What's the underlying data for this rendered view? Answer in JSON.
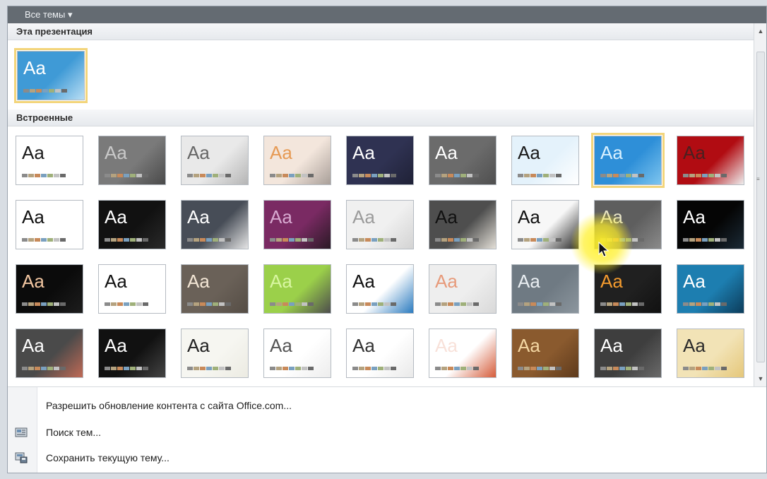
{
  "header": {
    "title": "Все темы ▾"
  },
  "sections": {
    "this_presentation": "Эта презентация",
    "builtin": "Встроенные"
  },
  "menu": [
    {
      "label": "Разрешить обновление контента с сайта Office.com...",
      "icon": ""
    },
    {
      "label": "Поиск тем...",
      "icon": "browse-themes-icon"
    },
    {
      "label": "Сохранить текущую тему...",
      "icon": "save-theme-icon"
    }
  ],
  "current_theme": {
    "label": "Aa",
    "bg": "#3f9ad6",
    "bg2": "#b9def4",
    "fg": "#ffffff"
  },
  "themes": [
    {
      "label": "Aa",
      "bg": "#ffffff",
      "bg2": "#ffffff",
      "fg": "#1a1a1a"
    },
    {
      "label": "Aa",
      "bg": "#7a7a7a",
      "bg2": "#4a4a4a",
      "fg": "#c9c9c9"
    },
    {
      "label": "Aa",
      "bg": "#e9e9e9",
      "bg2": "#b5b5b5",
      "fg": "#666666"
    },
    {
      "label": "Aa",
      "bg": "#f3e6dc",
      "bg2": "#a99f99",
      "fg": "#e69a54"
    },
    {
      "label": "Aa",
      "bg": "#2f3252",
      "bg2": "#1f2136",
      "fg": "#ffffff"
    },
    {
      "label": "Aa",
      "bg": "#6b6b6b",
      "bg2": "#4f4f4f",
      "fg": "#ffffff"
    },
    {
      "label": "Aa",
      "bg": "#e4f2fb",
      "bg2": "#ffffff",
      "fg": "#1a1a1a"
    },
    {
      "label": "Aa",
      "bg": "#2e8fd8",
      "bg2": "#7ec5ef",
      "fg": "#d7f0ff"
    },
    {
      "label": "Aa",
      "bg": "#b10c12",
      "bg2": "#eeeeee",
      "fg": "#4a2020"
    },
    {
      "label": "Aa",
      "bg": "#ffffff",
      "bg2": "#ffffff",
      "fg": "#111111"
    },
    {
      "label": "Aa",
      "bg": "#111111",
      "bg2": "#2a2a2a",
      "fg": "#ffffff"
    },
    {
      "label": "Aa",
      "bg": "#474d57",
      "bg2": "#e5e5e5",
      "fg": "#ffffff"
    },
    {
      "label": "Aa",
      "bg": "#7a2a63",
      "bg2": "#2a1a25",
      "fg": "#d7a9d0"
    },
    {
      "label": "Aa",
      "bg": "#f0f0f0",
      "bg2": "#d3d3d3",
      "fg": "#9b9b9b"
    },
    {
      "label": "Aa",
      "bg": "#4e4e4e",
      "bg2": "#e4e0d8",
      "fg": "#111111"
    },
    {
      "label": "Aa",
      "bg": "#f7f7f7",
      "bg2": "#262626",
      "fg": "#111111"
    },
    {
      "label": "Aa",
      "bg": "#5e5e5e",
      "bg2": "#8b8b8b",
      "fg": "#e7e4c7"
    },
    {
      "label": "Aa",
      "bg": "#050505",
      "bg2": "#1b2a36",
      "fg": "#ffffff"
    },
    {
      "label": "Aa",
      "bg": "#0b0b0b",
      "bg2": "#1d1d1d",
      "fg": "#f2c6a1"
    },
    {
      "label": "Aa",
      "bg": "#ffffff",
      "bg2": "#ffffff",
      "fg": "#111111"
    },
    {
      "label": "Aa",
      "bg": "#6a6158",
      "bg2": "#554d45",
      "fg": "#f3e6d5"
    },
    {
      "label": "Aa",
      "bg": "#9bd04a",
      "bg2": "#4d4d4d",
      "fg": "#d8f6a1"
    },
    {
      "label": "Aa",
      "bg": "#ffffff",
      "bg2": "#2b7bbf",
      "fg": "#111111"
    },
    {
      "label": "Aa",
      "bg": "#eeeeee",
      "bg2": "#d9d9d9",
      "fg": "#e79a7a"
    },
    {
      "label": "Aa",
      "bg": "#6f7a83",
      "bg2": "#8c969e",
      "fg": "#e9eef2"
    },
    {
      "label": "Aa",
      "bg": "#202020",
      "bg2": "#111111",
      "fg": "#f29a2e"
    },
    {
      "label": "Aa",
      "bg": "#1d7eb0",
      "bg2": "#0c3c5a",
      "fg": "#ffffff"
    },
    {
      "label": "Aa",
      "bg": "#4a4a4a",
      "bg2": "#c06a56",
      "fg": "#ffffff"
    },
    {
      "label": "Aa",
      "bg": "#111111",
      "bg2": "#444444",
      "fg": "#ffffff"
    },
    {
      "label": "Aa",
      "bg": "#f6f6f1",
      "bg2": "#ecebe2",
      "fg": "#222222"
    },
    {
      "label": "Aa",
      "bg": "#ffffff",
      "bg2": "#ededed",
      "fg": "#555555"
    },
    {
      "label": "Aa",
      "bg": "#ffffff",
      "bg2": "#e9e9e9",
      "fg": "#333333"
    },
    {
      "label": "Aa",
      "bg": "#ffffff",
      "bg2": "#d55c3a",
      "fg": "#f8e1d9"
    },
    {
      "label": "Aa",
      "bg": "#8a5a2e",
      "bg2": "#5e3a1c",
      "fg": "#f4d7a3"
    },
    {
      "label": "Aa",
      "bg": "#3e3e3e",
      "bg2": "#6a6a6a",
      "fg": "#ffffff"
    },
    {
      "label": "Aa",
      "bg": "#f2e3b6",
      "bg2": "#e5c77a",
      "fg": "#2b2b2b"
    }
  ]
}
